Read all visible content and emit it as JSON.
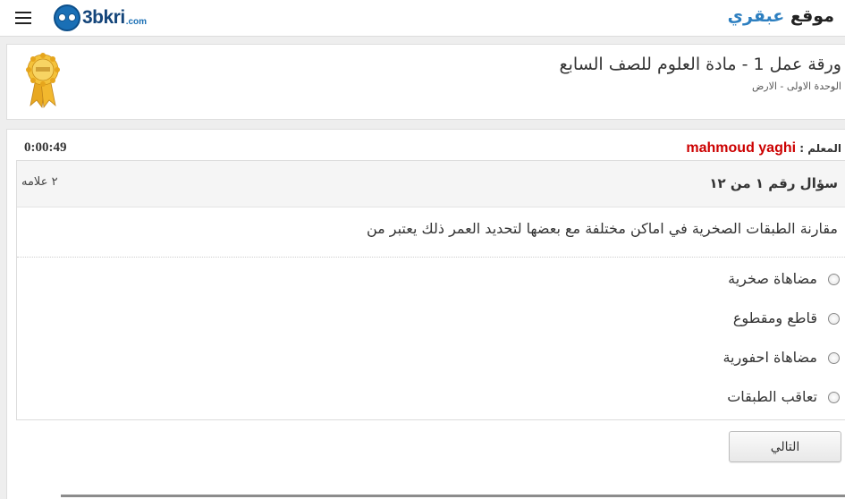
{
  "header": {
    "menu_icon": "hamburger-menu-icon",
    "logo_text": "3bkri",
    "logo_suffix": ".com",
    "site_title_prefix": "موقع",
    "site_title_accent": "عبقري",
    "accent_color": "#2d7fc0"
  },
  "worksheet": {
    "title": "ورقة عمل 1 - مادة العلوم للصف السابع",
    "subtitle": "الوحدة الاولى - الارض",
    "badge_icon": "award-medal-icon"
  },
  "quiz": {
    "teacher_label": "المعلم :",
    "teacher_name": "mahmoud yaghi",
    "timer": "0:00:49",
    "question_number": "سؤال رقم ١ من ١٢",
    "marks": "٢ علامه",
    "question_text": "مقارنة الطبقات الصخرية في اماكن مختلفة مع بعضها لتحديد العمر ذلك يعتبر من",
    "options": [
      {
        "label": "مضاهاة صخرية"
      },
      {
        "label": "قاطع ومقطوع"
      },
      {
        "label": "مضاهاة احفورية"
      },
      {
        "label": "تعاقب الطبقات"
      }
    ],
    "next_label": "التالي"
  }
}
